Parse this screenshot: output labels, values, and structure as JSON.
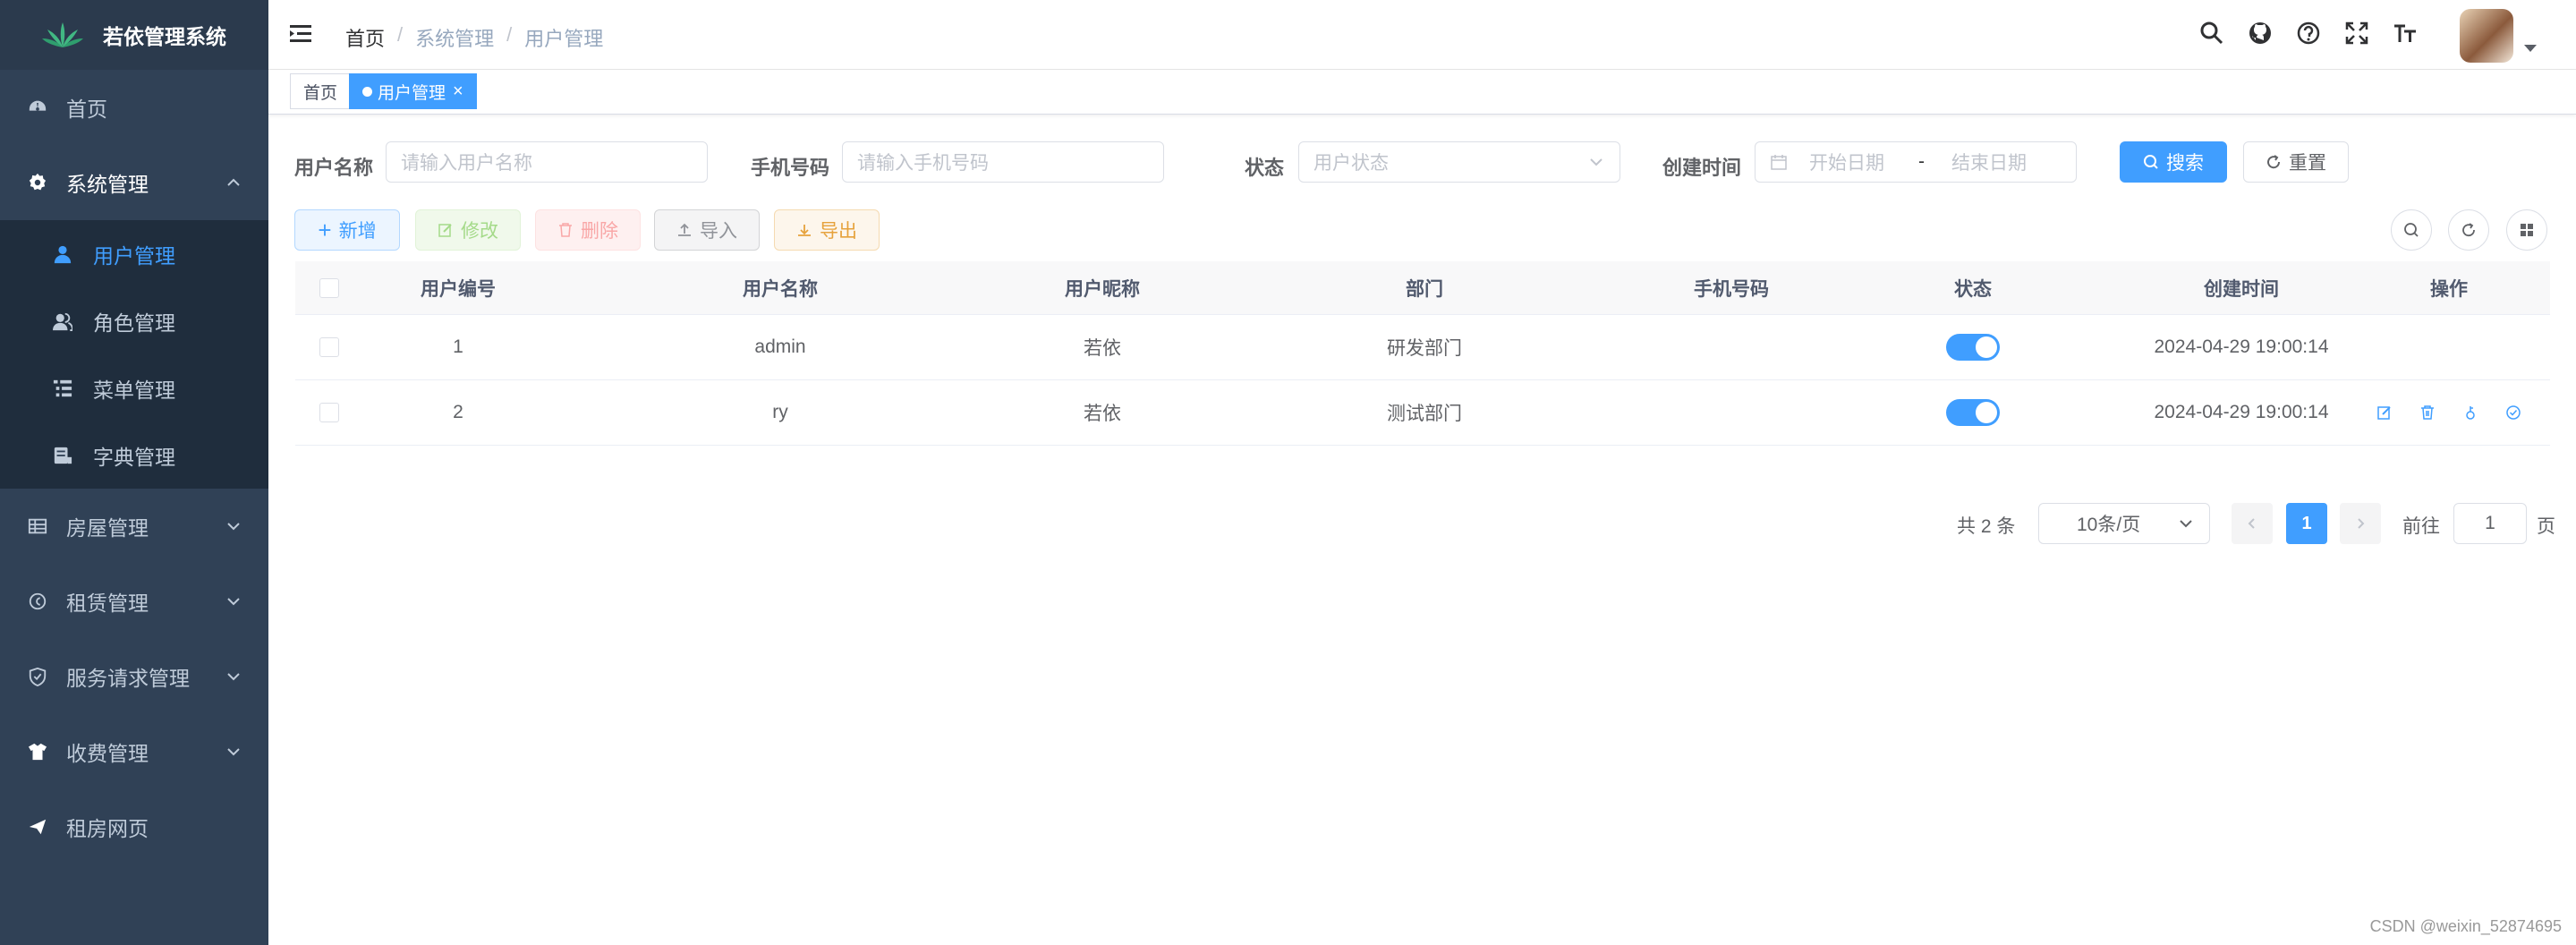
{
  "app": {
    "title": "若依管理系统"
  },
  "sidebar": {
    "items": [
      {
        "label": "首页",
        "icon": "dashboard-icon"
      },
      {
        "label": "系统管理",
        "icon": "gear-icon",
        "expanded": true,
        "children": [
          {
            "label": "用户管理",
            "icon": "user-icon",
            "active": true
          },
          {
            "label": "角色管理",
            "icon": "peoples-icon"
          },
          {
            "label": "菜单管理",
            "icon": "tree-table-icon"
          },
          {
            "label": "字典管理",
            "icon": "dict-icon"
          }
        ]
      },
      {
        "label": "房屋管理",
        "icon": "table-icon"
      },
      {
        "label": "租赁管理",
        "icon": "coin-icon"
      },
      {
        "label": "服务请求管理",
        "icon": "shield-icon"
      },
      {
        "label": "收费管理",
        "icon": "shirt-icon"
      },
      {
        "label": "租房网页",
        "icon": "send-icon"
      }
    ]
  },
  "header": {
    "breadcrumb": [
      "首页",
      "系统管理",
      "用户管理"
    ],
    "icons": [
      "search-icon",
      "github-icon",
      "question-icon",
      "fullscreen-icon",
      "font-size-icon"
    ]
  },
  "tags": [
    {
      "label": "首页",
      "active": false
    },
    {
      "label": "用户管理",
      "active": true
    }
  ],
  "search_form": {
    "username_label": "用户名称",
    "username_placeholder": "请输入用户名称",
    "phone_label": "手机号码",
    "phone_placeholder": "请输入手机号码",
    "status_label": "状态",
    "status_placeholder": "用户状态",
    "created_label": "创建时间",
    "start_placeholder": "开始日期",
    "range_sep": "-",
    "end_placeholder": "结束日期",
    "search_btn": "搜索",
    "reset_btn": "重置"
  },
  "toolbar": {
    "add": "新增",
    "edit": "修改",
    "delete": "删除",
    "import": "导入",
    "export": "导出"
  },
  "table": {
    "columns": [
      "用户编号",
      "用户名称",
      "用户昵称",
      "部门",
      "手机号码",
      "状态",
      "创建时间",
      "操作"
    ],
    "rows": [
      {
        "id": "1",
        "username": "admin",
        "nickname": "若依",
        "dept": "研发部门",
        "phone": "",
        "status_on": true,
        "created": "2024-04-29 19:00:14"
      },
      {
        "id": "2",
        "username": "ry",
        "nickname": "若依",
        "dept": "测试部门",
        "phone": "",
        "status_on": true,
        "created": "2024-04-29 19:00:14"
      }
    ]
  },
  "pagination": {
    "total": "共 2 条",
    "page_size": "10条/页",
    "current": "1",
    "goto_label": "前往",
    "goto_value": "1",
    "page_suffix": "页"
  },
  "watermark": "CSDN @weixin_52874695",
  "colors": {
    "primary": "#409eff",
    "sidebar_bg": "#304156",
    "submenu_bg": "#1f2d3d",
    "sidebar_text": "#bfcbd9"
  }
}
